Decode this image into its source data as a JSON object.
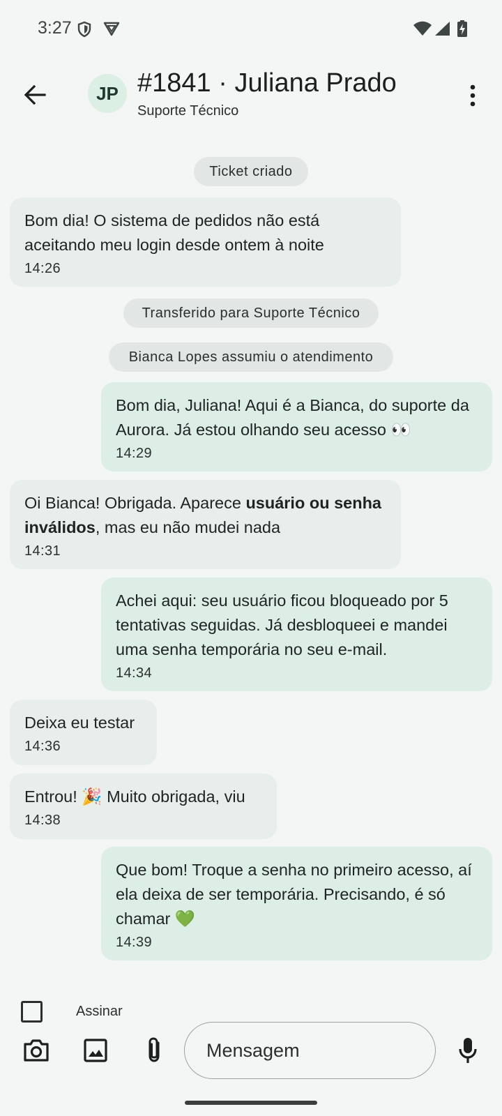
{
  "status_bar": {
    "time": "3:27"
  },
  "header": {
    "avatar_initials": "JP",
    "title": "#1841 · Juliana Prado",
    "subtitle": "Suporte Técnico"
  },
  "events": {
    "ticket_created": "Ticket criado",
    "transferred": "Transferido para Suporte Técnico",
    "assigned": "Bianca Lopes assumiu o atendimento"
  },
  "messages": [
    {
      "direction": "in",
      "text": "Bom dia! O sistema de pedidos não está aceitando meu login desde ontem à noite",
      "time": "14:26"
    },
    {
      "direction": "out",
      "text": "Bom dia, Juliana! Aqui é a Bianca, do suporte da Aurora. Já estou olhando seu acesso 👀",
      "time": "14:29"
    },
    {
      "direction": "in",
      "text_before": "Oi Bianca! Obrigada. Aparece ",
      "text_bold": "usuário ou senha inválidos",
      "text_after": ", mas eu não mudei nada",
      "time": "14:31"
    },
    {
      "direction": "out",
      "text": "Achei aqui: seu usuário ficou bloqueado por 5 tentativas seguidas. Já desbloqueei e mandei uma senha temporária no seu e-mail.",
      "time": "14:34"
    },
    {
      "direction": "in",
      "text": "Deixa eu testar",
      "time": "14:36"
    },
    {
      "direction": "in",
      "text": "Entrou! 🎉 Muito obrigada, viu",
      "time": "14:38"
    },
    {
      "direction": "out",
      "text": "Que bom! Troque a senha no primeiro acesso, aí ela deixa de ser temporária. Precisando, é só chamar 💚",
      "time": "14:39"
    }
  ],
  "composer": {
    "sign_label": "Assinar",
    "placeholder": "Mensagem"
  },
  "icons": {
    "back": "arrow-left-icon",
    "more": "more-vertical-icon",
    "camera": "camera-icon",
    "gallery": "image-icon",
    "attach": "paperclip-icon",
    "mic": "microphone-icon"
  },
  "colors": {
    "background": "#f3f6f5",
    "incoming_bubble": "#e8eeec",
    "outgoing_bubble": "#dceee6",
    "event_chip": "#e2e6e5",
    "avatar_bg": "#dcefe5"
  }
}
